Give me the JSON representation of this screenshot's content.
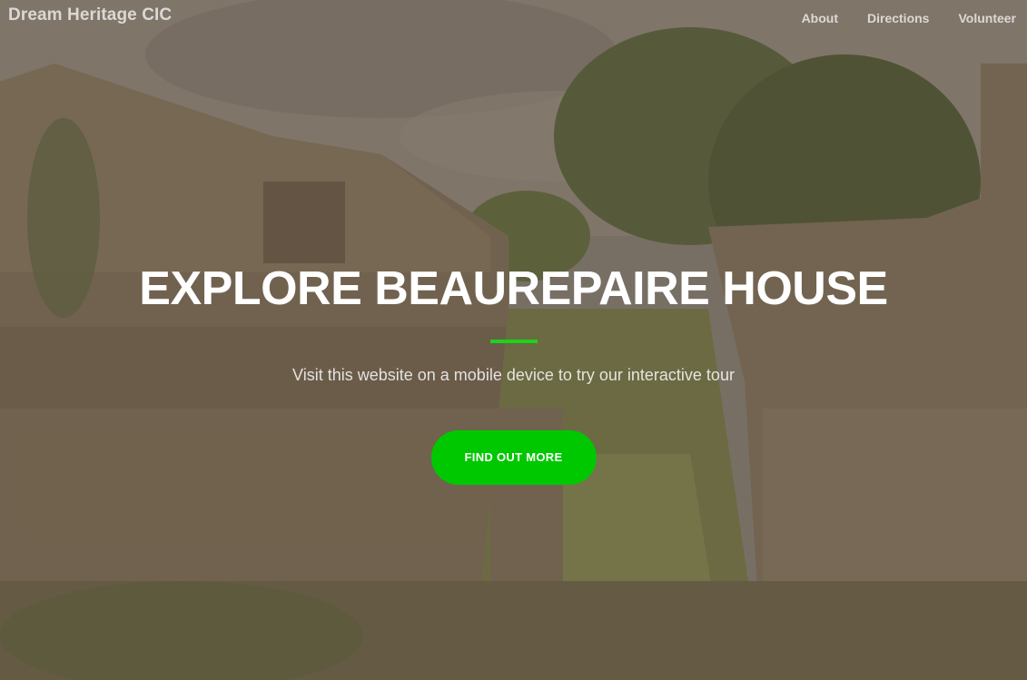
{
  "navbar": {
    "brand": "Dream Heritage CIC",
    "links": [
      {
        "label": "About"
      },
      {
        "label": "Directions"
      },
      {
        "label": "Volunteer"
      }
    ]
  },
  "hero": {
    "title": "EXPLORE BEAUREPAIRE HOUSE",
    "subtitle": "Visit this website on a mobile device to try our interactive tour",
    "button_label": "FIND OUT MORE",
    "background_image": "stone-ruins-with-trees-photo"
  },
  "colors": {
    "accent": "#00c800",
    "divider": "#1bd31b",
    "overlay": "#5c4c3c"
  }
}
